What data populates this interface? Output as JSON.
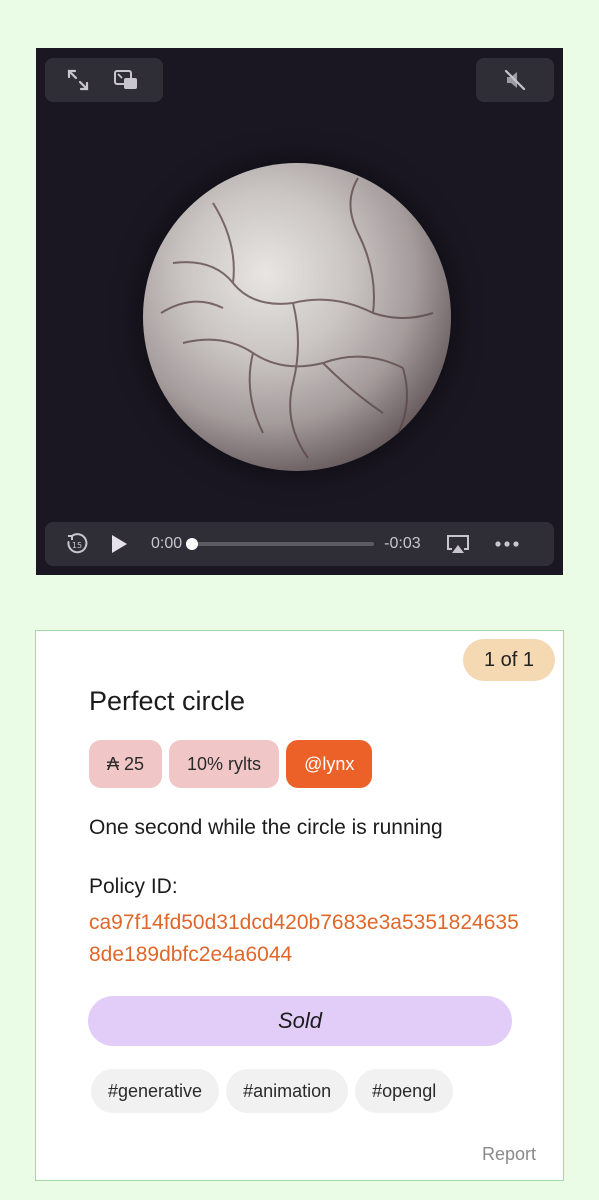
{
  "player": {
    "current_time": "0:00",
    "remaining_time": "-0:03",
    "progress": 0,
    "muted": true,
    "skip_back_seconds": "15"
  },
  "card": {
    "edition": "1 of 1",
    "title": "Perfect circle",
    "price": "₳ 25",
    "royalties": "10% rylts",
    "artist": "@lynx",
    "description": "One second while the circle is running",
    "policy_label": "Policy ID:",
    "policy_id": "ca97f14fd50d31dcd420b7683e3a53518246358de189dbfc2e4a6044",
    "status_button": "Sold",
    "tags": [
      "#generative",
      "#animation",
      "#opengl"
    ],
    "report_link": "Report"
  },
  "colors": {
    "page_background": "#eafce6",
    "accent": "#ec6128",
    "policy_text": "#e0672a",
    "sold_button": "#e2cdf8",
    "edition_badge": "#f4d9b3",
    "price_pill": "#f1c6c6"
  }
}
